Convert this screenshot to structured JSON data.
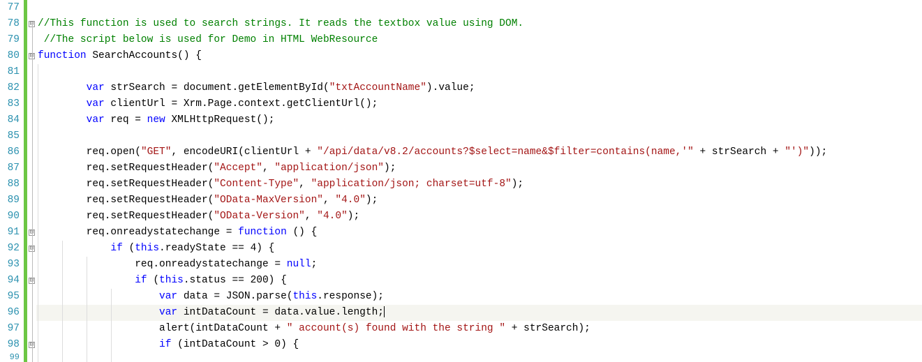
{
  "lines": {
    "n77": "77",
    "n78": "78",
    "n79": "79",
    "n80": "80",
    "n81": "81",
    "n82": "82",
    "n83": "83",
    "n84": "84",
    "n85": "85",
    "n86": "86",
    "n87": "87",
    "n88": "88",
    "n89": "89",
    "n90": "90",
    "n91": "91",
    "n92": "92",
    "n93": "93",
    "n94": "94",
    "n95": "95",
    "n96": "96",
    "n97": "97",
    "n98": "98",
    "n99": "99"
  },
  "fold_minus": "⊟",
  "code": {
    "l78": {
      "c1": "//This function is used to search strings. It reads the textbox value using DOM."
    },
    "l79": {
      "c1": " //The script below is used for Demo in HTML WebResource"
    },
    "l80": {
      "k1": "function",
      "t1": " SearchAccounts() {"
    },
    "l82": {
      "t1": "        ",
      "k1": "var",
      "t2": " strSearch = document.getElementById(",
      "s1": "\"txtAccountName\"",
      "t3": ").value;"
    },
    "l83": {
      "t1": "        ",
      "k1": "var",
      "t2": " clientUrl = Xrm.Page.context.getClientUrl();"
    },
    "l84": {
      "t1": "        ",
      "k1": "var",
      "t2": " req = ",
      "k2": "new",
      "t3": " XMLHttpRequest();"
    },
    "l86": {
      "t1": "        req.open(",
      "s1": "\"GET\"",
      "t2": ", encodeURI(clientUrl + ",
      "s2": "\"/api/data/v8.2/accounts?$select=name&$filter=contains(name,'\"",
      "t3": " + strSearch + ",
      "s3": "\"')\"",
      "t4": "));"
    },
    "l87": {
      "t1": "        req.setRequestHeader(",
      "s1": "\"Accept\"",
      "t2": ", ",
      "s2": "\"application/json\"",
      "t3": ");"
    },
    "l88": {
      "t1": "        req.setRequestHeader(",
      "s1": "\"Content-Type\"",
      "t2": ", ",
      "s2": "\"application/json; charset=utf-8\"",
      "t3": ");"
    },
    "l89": {
      "t1": "        req.setRequestHeader(",
      "s1": "\"OData-MaxVersion\"",
      "t2": ", ",
      "s2": "\"4.0\"",
      "t3": ");"
    },
    "l90": {
      "t1": "        req.setRequestHeader(",
      "s1": "\"OData-Version\"",
      "t2": ", ",
      "s2": "\"4.0\"",
      "t3": ");"
    },
    "l91": {
      "t1": "        req.onreadystatechange = ",
      "k1": "function",
      "t2": " () {"
    },
    "l92": {
      "t1": "            ",
      "k1": "if",
      "t2": " (",
      "k2": "this",
      "t3": ".readyState == 4) {"
    },
    "l93": {
      "t1": "                req.onreadystatechange = ",
      "k1": "null",
      "t2": ";"
    },
    "l94": {
      "t1": "                ",
      "k1": "if",
      "t2": " (",
      "k2": "this",
      "t3": ".status == 200) {"
    },
    "l95": {
      "t1": "                    ",
      "k1": "var",
      "t2": " data = JSON.parse(",
      "k2": "this",
      "t3": ".response);"
    },
    "l96": {
      "t1": "                    ",
      "k1": "var",
      "t2": " intDataCount = data.value.length;"
    },
    "l97": {
      "t1": "                    alert(intDataCount + ",
      "s1": "\" account(s) found with the string \"",
      "t2": " + strSearch);"
    },
    "l98": {
      "t1": "                    ",
      "k1": "if",
      "t2": " (intDataCount > 0) {"
    }
  }
}
